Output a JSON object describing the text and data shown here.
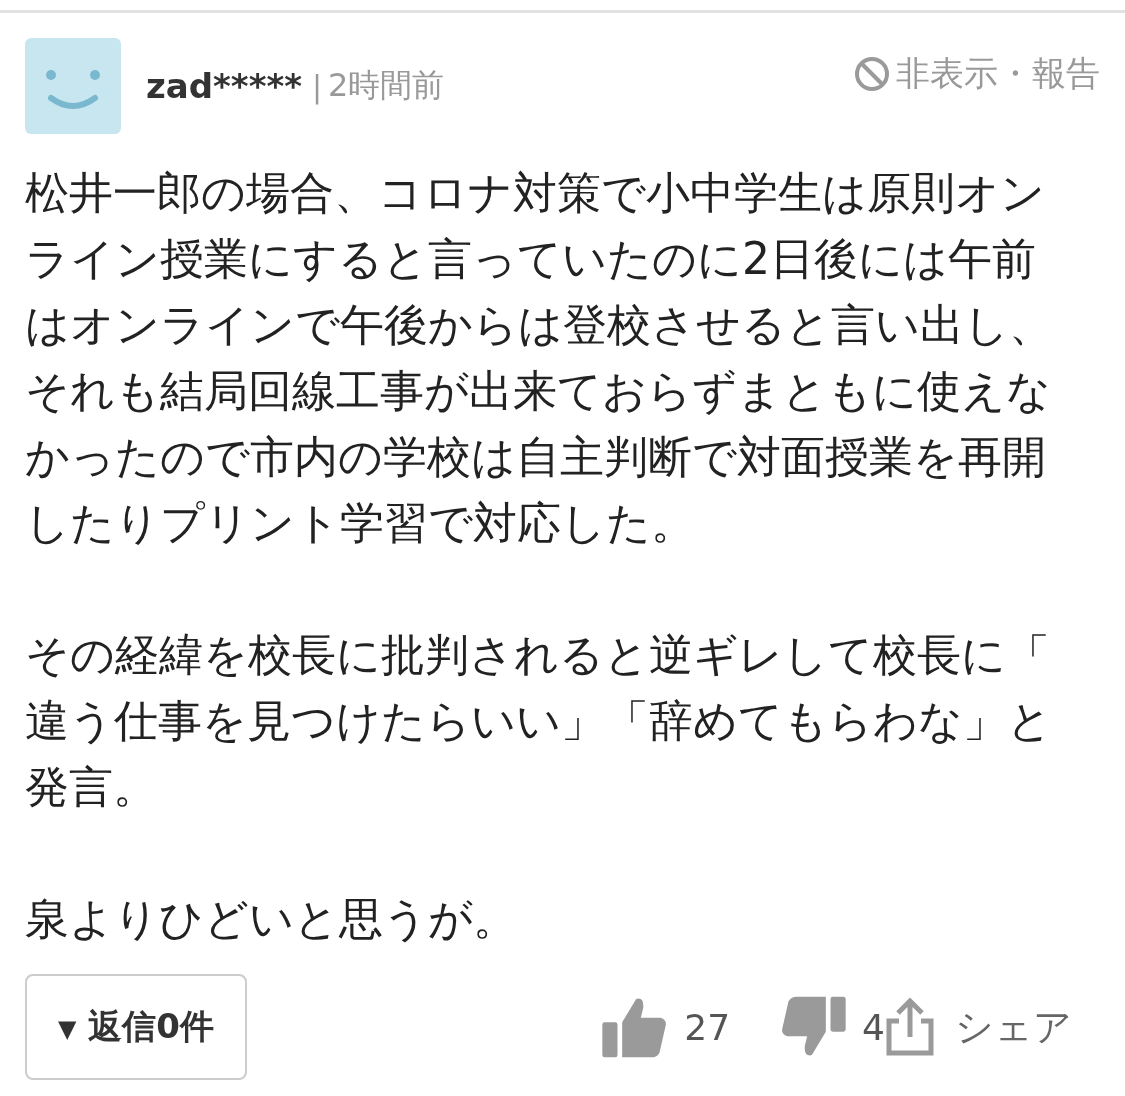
{
  "comment": {
    "user": "zad*****",
    "separator": "|",
    "time": "2時間前",
    "hide_report": "非表示・報告",
    "paragraphs": [
      "松井一郎の場合、コロナ対策で小中学生は原則オンライン授業にすると言っていたのに2日後には午前はオンラインで午後からは登校させると言い出し、それも結局回線工事が出来ておらずまともに使えなかったので市内の学校は自主判断で対面授業を再開したりプリント学習で対応した。",
      "その経緯を校長に批判されると逆ギレして校長に「違う仕事を見つけたらいい」「辞めてもらわな」と発言。",
      "泉よりひどいと思うが。"
    ],
    "reply_button": {
      "caret": "▼",
      "label": "返信0件"
    },
    "likes": "27",
    "dislikes": "4",
    "share": "シェア"
  }
}
